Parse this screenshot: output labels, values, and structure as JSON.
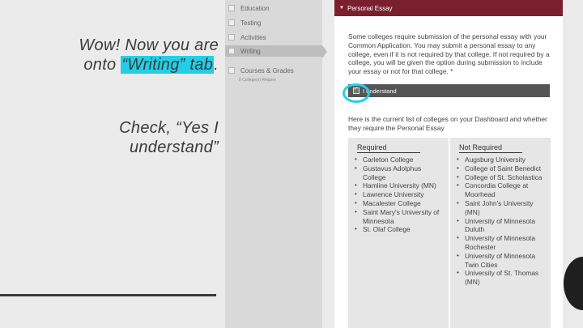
{
  "slide": {
    "line1_a": "Wow! Now you are",
    "line2_a": "onto ",
    "line2_highlight": "“Writing” tab",
    "line2_b": ".",
    "check_line1": "Check, “Yes I",
    "check_line2": "understand”"
  },
  "nav": {
    "items": [
      {
        "label": "Education"
      },
      {
        "label": "Testing"
      },
      {
        "label": "Activities"
      },
      {
        "label": "Writing"
      },
      {
        "label": "Courses & Grades"
      }
    ],
    "courses_sub": "0 College(s) Require"
  },
  "essay": {
    "header": "Personal Essay",
    "paragraph1": "Some colleges require submission of the personal essay with your Common Application. You may submit a personal essay to any college, even if it is not required by that college. If not required by a college, you will be given the option during submission to include your essay or not for that college. *",
    "understand_label": "I understand",
    "paragraph2": "Here is the current list of colleges on your Dashboard and whether they require the Personal Essay"
  },
  "colleges": {
    "required_header": "Required",
    "not_required_header": "Not Required",
    "required": [
      "Carleton College",
      "Gustavus Adolphus College",
      "Hamline University (MN)",
      "Lawrence University",
      "Macalester College",
      "Saint Mary's University of Minnesota",
      "St. Olaf College"
    ],
    "not_required": [
      "Augsburg University",
      "College of Saint Benedict",
      "College of St. Scholastica",
      "Concordia College at Moorhead",
      "Saint John's University (MN)",
      "University of Minnesota Duluth",
      "University of Minnesota Rochester",
      "University of Minnesota Twin Cities",
      "University of St. Thomas (MN)"
    ]
  },
  "colors": {
    "accent_highlight": "#22cfe6",
    "header_maroon": "#7a1f2e"
  }
}
